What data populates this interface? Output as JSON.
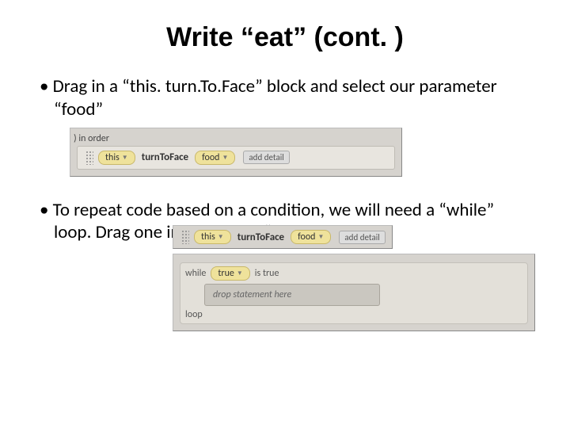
{
  "title": "Write “eat” (cont. )",
  "bullet1": "Drag in a “this. turn.To.Face” block and select our parameter “food”",
  "bullet2_prefix": "To repeat code based on a condition, we will need a “while” loop. Drag one in and select “true”",
  "block1": {
    "cut": ") in order",
    "this": "this",
    "method": "turnToFace",
    "food": "food",
    "detail": "add detail"
  },
  "block2": {
    "this": "this",
    "method": "turnToFace",
    "food": "food",
    "detail": "add detail",
    "while": "while",
    "true": "true",
    "istrue": "is true",
    "drop": "drop statement here",
    "loop": "loop"
  }
}
